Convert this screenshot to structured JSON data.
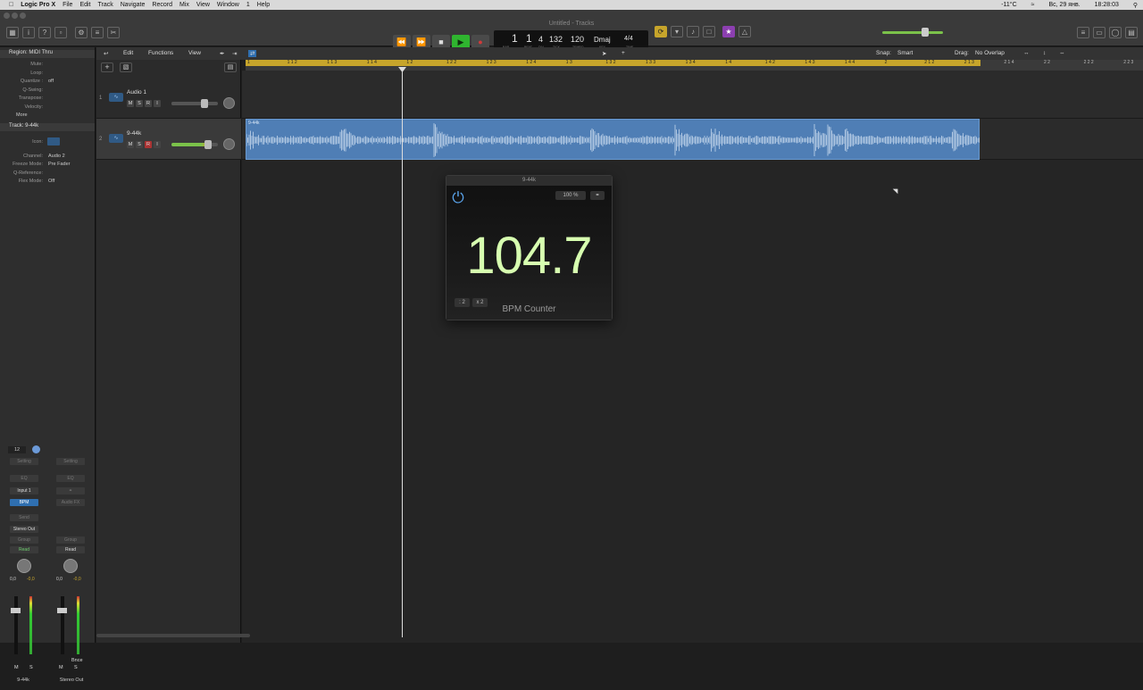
{
  "menubar": {
    "app": "Logic Pro X",
    "items": [
      "File",
      "Edit",
      "Track",
      "Navigate",
      "Record",
      "Mix",
      "View",
      "Window",
      "1",
      "Help"
    ],
    "status": [
      "-11°C",
      "Вс, 29 янв.",
      "18:28:03"
    ]
  },
  "window": {
    "title": "Untitled - Tracks"
  },
  "transport": {
    "bar": "1",
    "beat": "1",
    "div": "4",
    "tick": "132",
    "tempo": "120",
    "key": "Dmaj",
    "signature": "4/4",
    "labels": [
      "BAR",
      "BEAT",
      "DIV",
      "TICK",
      "TEMPO",
      "KEY",
      "TIME"
    ]
  },
  "editbar": {
    "edit": "Edit",
    "functions": "Functions",
    "view": "View",
    "snap_label": "Snap:",
    "snap_value": "Smart",
    "drag_label": "Drag:",
    "drag_value": "No Overlap"
  },
  "ruler": {
    "ticks": [
      "1",
      "1 1 2",
      "1 1 3",
      "1 1 4",
      "1 2",
      "1 2 2",
      "1 2 3",
      "1 2 4",
      "1 3",
      "1 3 2",
      "1 3 3",
      "1 3 4",
      "1 4",
      "1 4 2",
      "1 4 3",
      "1 4 4",
      "2",
      "2 1 2",
      "2 1 3",
      "2 1 4",
      "2 2",
      "2 2 2",
      "2 2 3"
    ]
  },
  "inspector": {
    "region_header": "Region: MIDI Thru",
    "region_rows": [
      {
        "k": "Mute:",
        "v": ""
      },
      {
        "k": "Loop:",
        "v": ""
      },
      {
        "k": "Quantize :",
        "v": "off"
      },
      {
        "k": "Q-Swing:",
        "v": ""
      },
      {
        "k": "Transpose:",
        "v": ""
      },
      {
        "k": "Velocity:",
        "v": ""
      }
    ],
    "more": "More",
    "track_header": "Track: 9-44k",
    "track_rows": [
      {
        "k": "Icon:",
        "v": ""
      },
      {
        "k": "Channel:",
        "v": "Audio 2"
      },
      {
        "k": "Freeze Mode:",
        "v": "Pre Fader"
      },
      {
        "k": "Q-Reference:",
        "v": ""
      },
      {
        "k": "Flex Mode:",
        "v": "Off"
      }
    ]
  },
  "tracks": [
    {
      "num": "1",
      "name": "Audio 1",
      "buttons": [
        "M",
        "S",
        "R",
        "I"
      ],
      "fader": 0.72
    },
    {
      "num": "2",
      "name": "9-44k",
      "buttons": [
        "M",
        "S",
        "R",
        "I"
      ],
      "fader": 0.78
    }
  ],
  "region": {
    "name": "9-44k"
  },
  "plugin": {
    "title": "9-44k",
    "zoom": "100 %",
    "bpm": "104.7",
    "half": ": 2",
    "double": "x 2",
    "name": "BPM Counter"
  },
  "mixer": {
    "strip1": {
      "value": "12",
      "input": "Input 1",
      "plugin": "BPM",
      "output": "Stereo Out",
      "automation": "Read",
      "gain_left": "0,0",
      "gain_right": "-0,0",
      "name": "9-44k",
      "mute": "M",
      "solo": "S"
    },
    "strip2": {
      "automation": "Read",
      "gain_left": "0,0",
      "gain_right": "-0,0",
      "bnce": "Bnce",
      "name": "Stereo Out",
      "mute": "M",
      "solo": "S"
    },
    "slot_labels": [
      "Setting",
      "EQ",
      "Send",
      "Group",
      "Audio FX"
    ]
  },
  "colors": {
    "cycle": "#c7a52b",
    "region": "#4f7eb5",
    "play": "#2fb52f",
    "record": "#d23a3a",
    "bpm": "#d7ffb0"
  }
}
